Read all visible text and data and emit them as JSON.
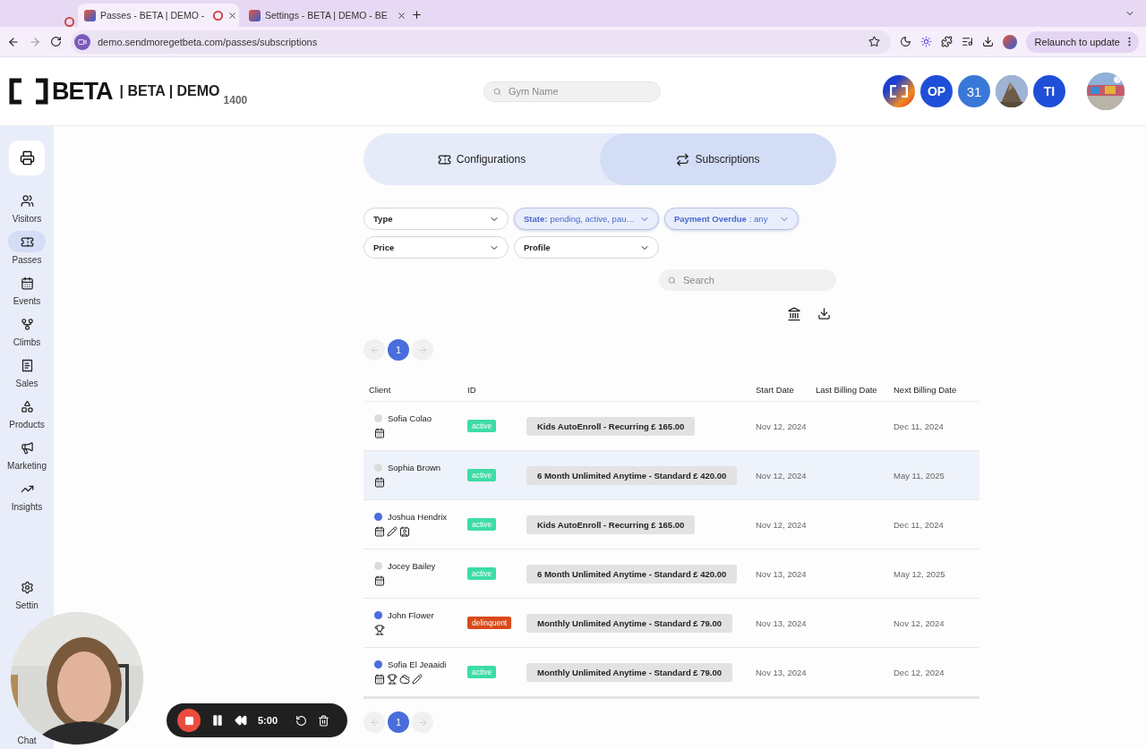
{
  "browser": {
    "tabs": [
      {
        "title": "Passes - BETA | DEMO -",
        "selected": true,
        "recording": true
      },
      {
        "title": "Settings - BETA | DEMO - BE",
        "selected": false,
        "recording": false
      }
    ],
    "url": "demo.sendmoregetbeta.com/passes/subscriptions",
    "relaunch": "Relaunch to update"
  },
  "header": {
    "brand": "BETA",
    "subtitle": "| BETA | DEMO",
    "number": "1400",
    "search_placeholder": "Gym Name",
    "avatars": [
      {
        "kind": "logo"
      },
      {
        "kind": "initials",
        "text": "OP"
      },
      {
        "kind": "calendar",
        "text": "31"
      },
      {
        "kind": "picture"
      },
      {
        "kind": "initials",
        "text": "TI"
      }
    ]
  },
  "sidebar": {
    "items": [
      {
        "label": "Visitors",
        "selected": false
      },
      {
        "label": "Passes",
        "selected": true
      },
      {
        "label": "Events",
        "selected": false
      },
      {
        "label": "Climbs",
        "selected": false
      },
      {
        "label": "Sales",
        "selected": false
      },
      {
        "label": "Products",
        "selected": false
      },
      {
        "label": "Marketing",
        "selected": false
      },
      {
        "label": "Insights",
        "selected": false
      }
    ],
    "bottom_items": [
      {
        "label": "Settin"
      },
      {
        "label": "Chat"
      }
    ]
  },
  "tabs": [
    {
      "label": "Configurations",
      "selected": false
    },
    {
      "label": "Subscriptions",
      "selected": true
    }
  ],
  "filters": [
    {
      "label": "Type",
      "active": false
    },
    {
      "label": "State:",
      "value": "pending, active, pau…",
      "active": true
    },
    {
      "label": "Payment Overdue",
      "value": ": any",
      "active": true
    },
    {
      "label": "Price",
      "active": false
    },
    {
      "label": "Profile",
      "active": false
    }
  ],
  "search_placeholder": "Search",
  "pagination_top": {
    "page": "1"
  },
  "table": {
    "columns": [
      "Client",
      "ID",
      "Start Date",
      "Last Billing Date",
      "Next Billing Date"
    ],
    "rows": [
      {
        "client": "Sofia Colao",
        "color": "#dcdcdc",
        "icons": [
          {
            "kind": "calendar"
          }
        ],
        "status": {
          "label": "active",
          "kind": "active"
        },
        "plan": "Kids AutoEnroll - Recurring £ 165.00",
        "start": "Nov 12, 2024",
        "next": "Dec 11, 2024",
        "selected": false
      },
      {
        "client": "Sophia Brown",
        "color": "#dcdcdc",
        "icons": [
          {
            "kind": "calendar"
          }
        ],
        "status": {
          "label": "active",
          "kind": "active"
        },
        "plan": "6 Month Unlimited Anytime - Standard £ 420.00",
        "start": "Nov 12, 2024",
        "next": "May 11, 2025",
        "selected": true
      },
      {
        "client": "Joshua Hendrix",
        "color": "#4a6ddc",
        "icons": [
          {
            "kind": "calendar"
          },
          {
            "kind": "pencil"
          },
          {
            "kind": "badge"
          }
        ],
        "status": {
          "label": "active",
          "kind": "active"
        },
        "plan": "Kids AutoEnroll - Recurring £ 165.00",
        "start": "Nov 12, 2024",
        "next": "Dec 11, 2024",
        "selected": false
      },
      {
        "client": "Jocey Bailey",
        "color": "#dcdcdc",
        "icons": [
          {
            "kind": "calendar"
          }
        ],
        "status": {
          "label": "active",
          "kind": "active"
        },
        "plan": "6 Month Unlimited Anytime - Standard £ 420.00",
        "start": "Nov 13, 2024",
        "next": "May 12, 2025",
        "selected": false
      },
      {
        "client": "John Flower",
        "color": "#4a6ddc",
        "icons": [
          {
            "kind": "trophy"
          }
        ],
        "status": {
          "label": "delinquent",
          "kind": "delinquent"
        },
        "plan": "Monthly Unlimited Anytime - Standard £ 79.00",
        "start": "Nov 13, 2024",
        "next": "Nov 12, 2024",
        "selected": false
      },
      {
        "client": "Sofia El Jeaaidi",
        "color": "#4a6ddc",
        "icons": [
          {
            "kind": "calendar"
          },
          {
            "kind": "trophy"
          },
          {
            "kind": "cloud"
          },
          {
            "kind": "pencil"
          }
        ],
        "status": {
          "label": "active",
          "kind": "active"
        },
        "plan": "Monthly Unlimited Anytime - Standard £ 79.00",
        "start": "Nov 13, 2024",
        "next": "Dec 12, 2024",
        "selected": false
      }
    ]
  },
  "pagination_bottom": {
    "page": "1"
  },
  "recorder": {
    "time": "5:00"
  }
}
